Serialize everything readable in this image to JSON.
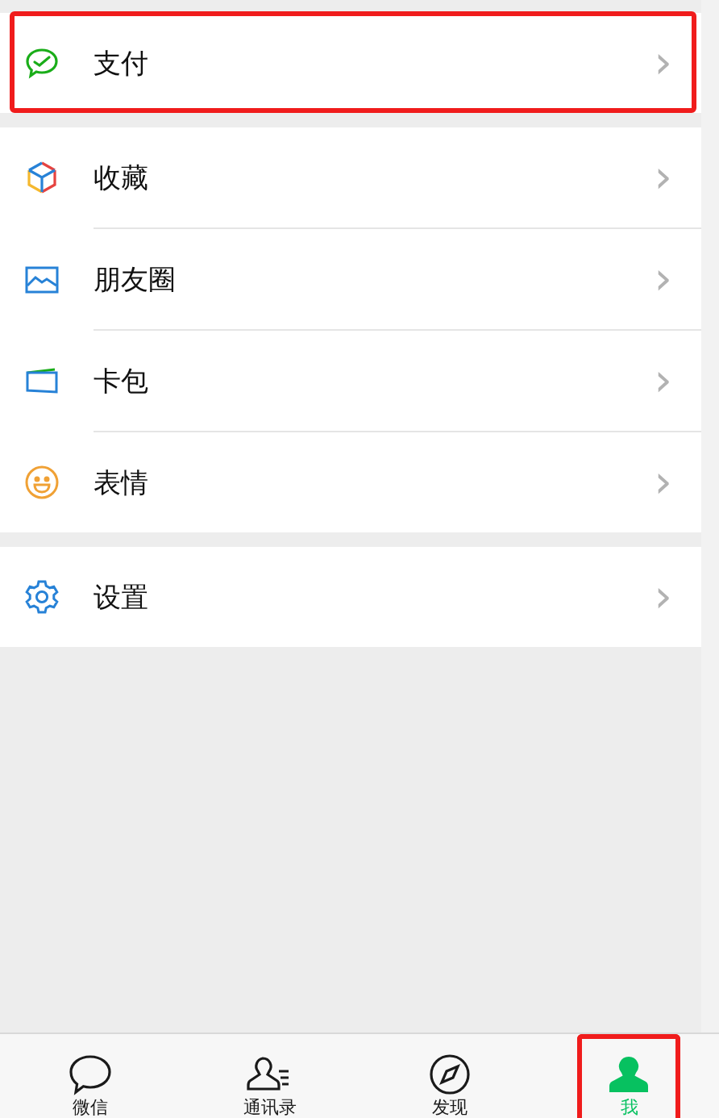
{
  "sections": [
    {
      "items": [
        {
          "kind": "pay",
          "label": "支付",
          "chevron": "›",
          "highlighted": true
        }
      ]
    },
    {
      "items": [
        {
          "kind": "favorites",
          "label": "收藏",
          "chevron": "›",
          "highlighted": false
        },
        {
          "kind": "moments",
          "label": "朋友圈",
          "chevron": "›",
          "highlighted": false
        },
        {
          "kind": "cards",
          "label": "卡包",
          "chevron": "›",
          "highlighted": false
        },
        {
          "kind": "stickers",
          "label": "表情",
          "chevron": "›",
          "highlighted": false
        }
      ]
    },
    {
      "items": [
        {
          "kind": "settings",
          "label": "设置",
          "chevron": "›",
          "highlighted": false
        }
      ]
    }
  ],
  "tab_bar": [
    {
      "kind": "chats",
      "label": "微信",
      "selected": false,
      "highlighted": false
    },
    {
      "kind": "contacts",
      "label": "通讯录",
      "selected": false,
      "highlighted": false
    },
    {
      "kind": "discover",
      "label": "发现",
      "selected": false,
      "highlighted": false
    },
    {
      "kind": "me",
      "label": "我",
      "selected": true,
      "highlighted": true
    }
  ]
}
